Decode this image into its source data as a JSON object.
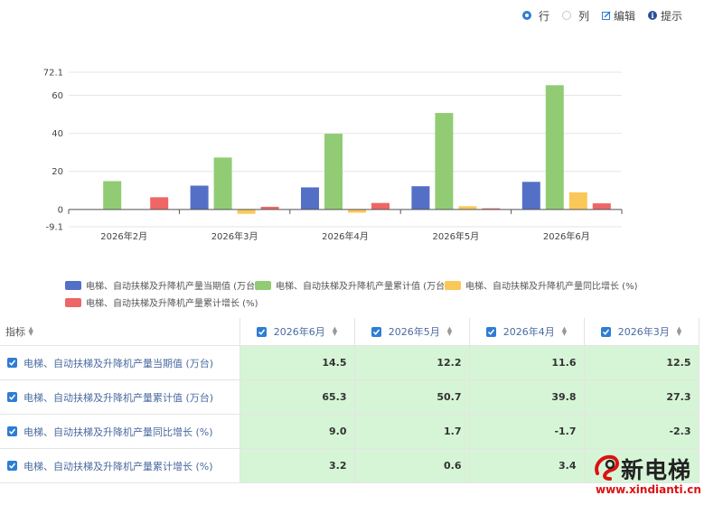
{
  "toolbar": {
    "row_label": "行",
    "col_label": "列",
    "edit_label": "编辑",
    "tip_label": "提示",
    "icons": [
      "radio-selected-icon",
      "radio-unselected-icon",
      "edit-icon",
      "info-icon"
    ],
    "accent": "#2f7dd3"
  },
  "chart_data": {
    "type": "bar",
    "categories": [
      "2026年2月",
      "2026年3月",
      "2026年4月",
      "2026年5月",
      "2026年6月"
    ],
    "ylim": [
      -9.1,
      72.1
    ],
    "yticks": [
      "72.1",
      "60",
      "40",
      "20",
      "0",
      "-9.1"
    ],
    "series": [
      {
        "name": "电梯、自动扶梯及升降机产量当期值 (万台)",
        "color": "#5470c6",
        "values": [
          null,
          12.5,
          11.6,
          12.2,
          14.5
        ]
      },
      {
        "name": "电梯、自动扶梯及升降机产量累计值 (万台)",
        "color": "#91cc75",
        "values": [
          14.9,
          27.3,
          39.8,
          50.7,
          65.3
        ]
      },
      {
        "name": "电梯、自动扶梯及升降机产量同比增长 (%)",
        "color": "#fac858",
        "values": [
          null,
          -2.3,
          -1.7,
          1.7,
          9.0
        ]
      },
      {
        "name": "电梯、自动扶梯及升降机产量累计增长 (%)",
        "color": "#ee6666",
        "values": [
          6.4,
          1.4,
          3.4,
          0.6,
          3.2
        ]
      }
    ],
    "legend_position": "bottom",
    "grid": true
  },
  "table": {
    "indicator_header": "指标",
    "months": [
      "2026年6月",
      "2026年5月",
      "2026年4月",
      "2026年3月"
    ],
    "rows": [
      {
        "name": "电梯、自动扶梯及升降机产量当期值 (万台)",
        "values": [
          "14.5",
          "12.2",
          "11.6",
          "12.5"
        ]
      },
      {
        "name": "电梯、自动扶梯及升降机产量累计值 (万台)",
        "values": [
          "65.3",
          "50.7",
          "39.8",
          "27.3"
        ]
      },
      {
        "name": "电梯、自动扶梯及升降机产量同比增长 (%)",
        "values": [
          "9.0",
          "1.7",
          "-1.7",
          "-2.3"
        ]
      },
      {
        "name": "电梯、自动扶梯及升降机产量累计增长 (%)",
        "values": [
          "3.2",
          "0.6",
          "3.4",
          ""
        ]
      }
    ],
    "highlight_color": "#d6f5d6"
  },
  "watermark": {
    "name": "新电梯",
    "url_prefix": "www.",
    "url_brand": "xindianti",
    "url_suffix": ".cn"
  }
}
